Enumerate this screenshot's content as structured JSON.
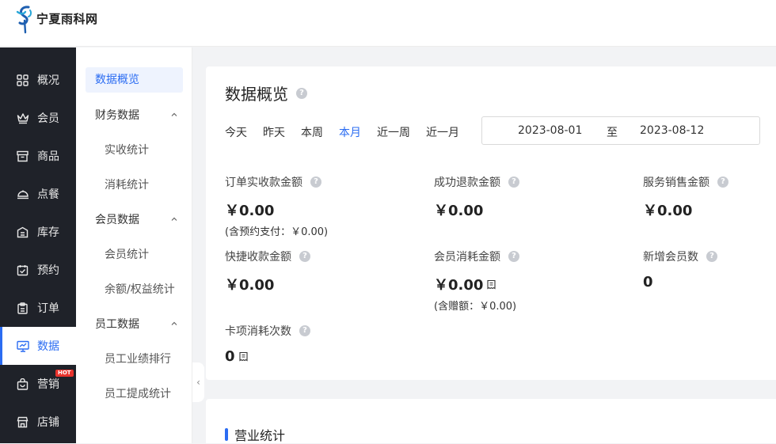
{
  "brand": {
    "name": "宁夏雨科网"
  },
  "sidebar": {
    "items": [
      {
        "label": "概况",
        "icon": "grid-icon"
      },
      {
        "label": "会员",
        "icon": "crown-icon"
      },
      {
        "label": "商品",
        "icon": "store-box-icon"
      },
      {
        "label": "点餐",
        "icon": "dish-icon"
      },
      {
        "label": "库存",
        "icon": "inventory-icon"
      },
      {
        "label": "预约",
        "icon": "calendar-check-icon"
      },
      {
        "label": "订单",
        "icon": "clipboard-icon"
      },
      {
        "label": "数据",
        "icon": "monitor-chart-icon",
        "active": true
      },
      {
        "label": "营销",
        "icon": "bag-icon",
        "badge": "HOT"
      },
      {
        "label": "店铺",
        "icon": "shop-icon"
      }
    ],
    "accent": "#2b6cf2"
  },
  "subnav": {
    "active": "数据概览",
    "groups": [
      {
        "label": "财务数据",
        "items": [
          "实收统计",
          "消耗统计"
        ]
      },
      {
        "label": "会员数据",
        "items": [
          "会员统计",
          "余额/权益统计"
        ]
      },
      {
        "label": "员工数据",
        "items": [
          "员工业绩排行",
          "员工提成统计"
        ]
      }
    ]
  },
  "overview": {
    "title": "数据概览",
    "ranges": [
      "今天",
      "昨天",
      "本周",
      "本月",
      "近一周",
      "近一月"
    ],
    "selected_range": "本月",
    "date_start": "2023-08-01",
    "date_sep": "至",
    "date_end": "2023-08-12",
    "metrics": [
      {
        "label": "订单实收款金额",
        "value": "￥0.00",
        "sub": "(含预约支付：￥0.00)"
      },
      {
        "label": "成功退款金额",
        "value": "￥0.00"
      },
      {
        "label": "服务销售金额",
        "value": "￥0.00"
      },
      {
        "label": "快捷收款金额",
        "value": "￥0.00"
      },
      {
        "label": "会员消耗金额",
        "value": "￥0.00",
        "sub": "(含赠额：￥0.00)"
      },
      {
        "label": "新增会员数",
        "value": "0"
      },
      {
        "label": "卡项消耗次数",
        "value": "0"
      }
    ]
  },
  "business": {
    "title": "营业统计"
  },
  "icons": {
    "help": "?",
    "collapse": "‹"
  }
}
